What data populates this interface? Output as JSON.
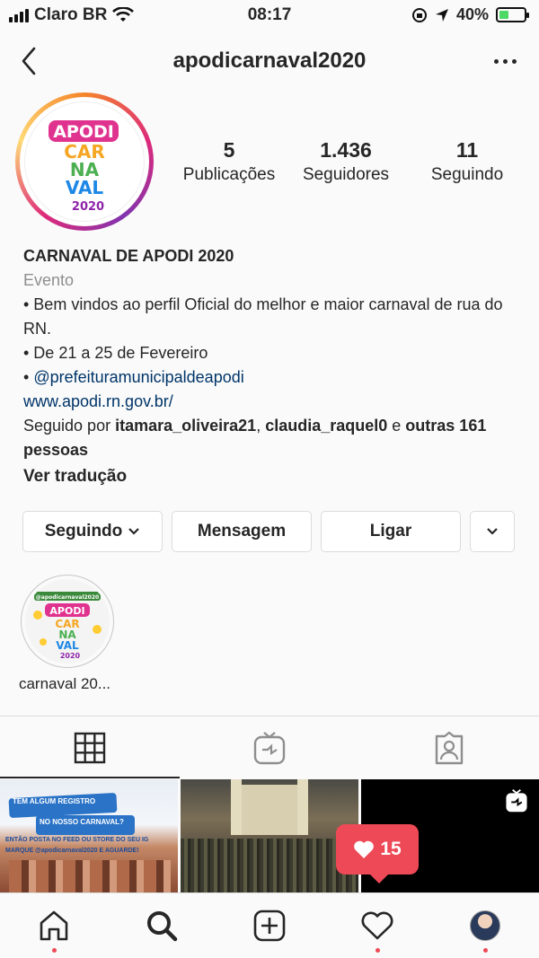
{
  "status": {
    "carrier": "Claro BR",
    "time": "08:17",
    "battery": "40%",
    "battery_level": 0.4
  },
  "header": {
    "username": "apodicarnaval2020"
  },
  "profile": {
    "avatar_text": [
      "APODI",
      "CAR",
      "NA",
      "VAL",
      "2020"
    ],
    "stats": [
      {
        "value": "5",
        "label": "Publicações"
      },
      {
        "value": "1.436",
        "label": "Seguidores"
      },
      {
        "value": "11",
        "label": "Seguindo"
      }
    ]
  },
  "bio": {
    "name": "CARNAVAL DE APODI 2020",
    "category": "Evento",
    "line1": "• Bem vindos ao perfil Oficial do melhor e maior carnaval de rua do RN.",
    "line2": "• De 21 a 25 de Fevereiro",
    "line3_prefix": "• ",
    "line3_mention": "@prefeituramunicipaldeapodi",
    "website": "www.apodi.rn.gov.br/",
    "followed_prefix": "Seguido por ",
    "followed_user1": "itamara_oliveira21",
    "followed_sep": ", ",
    "followed_user2": "claudia_raquel0",
    "followed_and": " e ",
    "followed_rest": "outras 161 pessoas",
    "translate": "Ver tradução"
  },
  "actions": {
    "following": "Seguindo",
    "message": "Mensagem",
    "call": "Ligar"
  },
  "highlight": {
    "label": "carnaval 20...",
    "image_text": [
      "APODI",
      "CAR",
      "NA",
      "VAL",
      "2020"
    ],
    "image_caption": "@apodicarnaval2020"
  },
  "grid": {
    "post1_text": [
      "TEM ALGUM REGISTRO",
      "NO NOSSO CARNAVAL?",
      "ENTÃO POSTA NO FEED OU STORE DO SEU IG",
      "MARQUE @apodicarnaval2020 E AGUARDE!"
    ]
  },
  "notification": {
    "likes": "15"
  },
  "colors": {
    "accent_red": "#ed4956",
    "link_blue": "#003569"
  }
}
